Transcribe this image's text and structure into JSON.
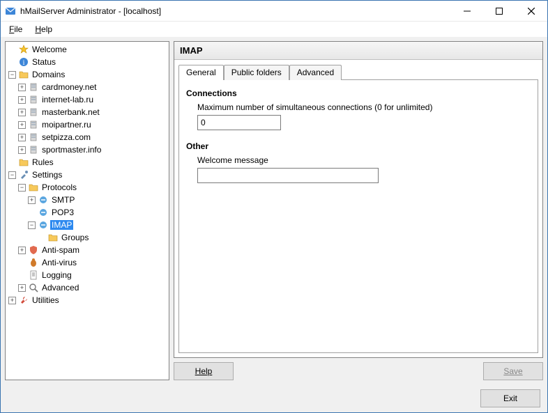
{
  "window": {
    "title": "hMailServer Administrator - [localhost]"
  },
  "menu": {
    "file": "File",
    "help": "Help"
  },
  "tree": {
    "welcome": "Welcome",
    "status": "Status",
    "domains": "Domains",
    "domain_items": [
      "cardmoney.net",
      "internet-lab.ru",
      "masterbank.net",
      "moipartner.ru",
      "setpizza.com",
      "sportmaster.info"
    ],
    "rules": "Rules",
    "settings": "Settings",
    "protocols": "Protocols",
    "smtp": "SMTP",
    "pop3": "POP3",
    "imap": "IMAP",
    "groups": "Groups",
    "antispam": "Anti-spam",
    "antivirus": "Anti-virus",
    "logging": "Logging",
    "advanced": "Advanced",
    "utilities": "Utilities"
  },
  "panel": {
    "title": "IMAP",
    "tabs": {
      "general": "General",
      "public": "Public folders",
      "advanced": "Advanced"
    },
    "section_connections": "Connections",
    "max_conn_label": "Maximum number of simultaneous connections (0 for unlimited)",
    "max_conn_value": "0",
    "section_other": "Other",
    "welcome_label": "Welcome message",
    "welcome_value": ""
  },
  "buttons": {
    "help": "Help",
    "save": "Save",
    "exit": "Exit"
  }
}
